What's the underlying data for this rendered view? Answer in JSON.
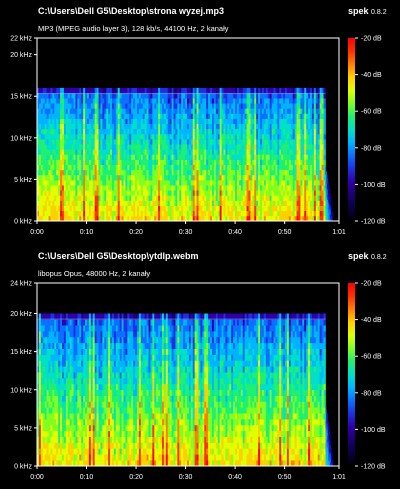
{
  "app": {
    "name": "spek",
    "version": "0.8.2"
  },
  "colormap": [
    "#000000",
    "#0a0040",
    "#1a006e",
    "#2e00a8",
    "#1e30e0",
    "#0a70ff",
    "#00b4ff",
    "#00e0c8",
    "#20f070",
    "#80ff20",
    "#e0ff00",
    "#ffd000",
    "#ff8000",
    "#ff3000",
    "#ff0000"
  ],
  "panels": [
    {
      "file_path": "C:\\Users\\Dell G5\\Desktop\\strona wyzej.mp3",
      "file_info": "MP3 (MPEG audio layer 3), 128 kb/s, 44100 Hz, 2 kanały",
      "freq_ticks": [
        "22 kHz",
        "20 kHz",
        "15 kHz",
        "10 kHz",
        "5 kHz",
        "0 kHz"
      ],
      "freq_tick_values": [
        22,
        20,
        15,
        10,
        5,
        0
      ],
      "freq_max": 22,
      "cutoff_khz": 16,
      "end_fraction": 0.955,
      "time_ticks": [
        "0:00",
        "0:10",
        "0:20",
        "0:30",
        "0:40",
        "0:50",
        "1:01"
      ],
      "time_tick_fractions": [
        0,
        0.164,
        0.328,
        0.492,
        0.656,
        0.82,
        1
      ],
      "db_ticks": [
        "-20 dB",
        "-40 dB",
        "-60 dB",
        "-80 dB",
        "-100 dB",
        "-120 dB"
      ]
    },
    {
      "file_path": "C:\\Users\\Dell G5\\Desktop\\ytdlp.webm",
      "file_info": "libopus Opus, 48000 Hz, 2 kanały",
      "freq_ticks": [
        "24 kHz",
        "20 kHz",
        "15 kHz",
        "10 kHz",
        "5 kHz",
        "0 kHz"
      ],
      "freq_tick_values": [
        24,
        20,
        15,
        10,
        5,
        0
      ],
      "freq_max": 24,
      "cutoff_khz": 20,
      "end_fraction": 0.955,
      "time_ticks": [
        "0:00",
        "0:10",
        "0:20",
        "0:30",
        "0:40",
        "0:50",
        "1:01"
      ],
      "time_tick_fractions": [
        0,
        0.164,
        0.328,
        0.492,
        0.656,
        0.82,
        1
      ],
      "db_ticks": [
        "-20 dB",
        "-40 dB",
        "-60 dB",
        "-80 dB",
        "-100 dB",
        "-120 dB"
      ]
    }
  ]
}
